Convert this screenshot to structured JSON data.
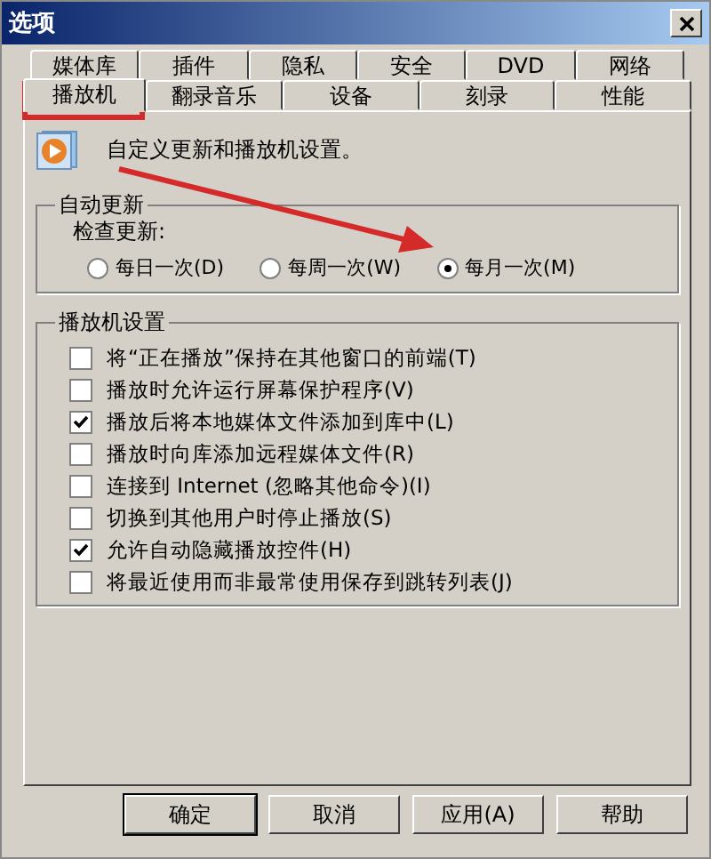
{
  "window": {
    "title": "选项"
  },
  "tab_rows": [
    [
      {
        "label": "媒体库",
        "selected": false
      },
      {
        "label": "插件",
        "selected": false
      },
      {
        "label": "隐私",
        "selected": false
      },
      {
        "label": "安全",
        "selected": false
      },
      {
        "label": "DVD",
        "selected": false
      },
      {
        "label": "网络",
        "selected": false
      }
    ],
    [
      {
        "label": "播放机",
        "selected": true
      },
      {
        "label": "翻录音乐",
        "selected": false
      },
      {
        "label": "设备",
        "selected": false
      },
      {
        "label": "刻录",
        "selected": false
      },
      {
        "label": "性能",
        "selected": false
      }
    ]
  ],
  "header": "自定义更新和播放机设置。",
  "auto_update": {
    "title": "自动更新",
    "label": "检查更新:",
    "options": [
      {
        "label": "每日一次(D)",
        "selected": false
      },
      {
        "label": "每周一次(W)",
        "selected": false
      },
      {
        "label": "每月一次(M)",
        "selected": true
      }
    ]
  },
  "player_settings": {
    "title": "播放机设置",
    "items": [
      {
        "label": "将“正在播放”保持在其他窗口的前端(T)",
        "checked": false
      },
      {
        "label": "播放时允许运行屏幕保护程序(V)",
        "checked": false
      },
      {
        "label": "播放后将本地媒体文件添加到库中(L)",
        "checked": true
      },
      {
        "label": "播放时向库添加远程媒体文件(R)",
        "checked": false
      },
      {
        "label": "连接到 Internet (忽略其他命令)(I)",
        "checked": false
      },
      {
        "label": "切换到其他用户时停止播放(S)",
        "checked": false
      },
      {
        "label": "允许自动隐藏播放控件(H)",
        "checked": true
      },
      {
        "label": "将最近使用而非最常使用保存到跳转列表(J)",
        "checked": false
      }
    ]
  },
  "buttons": [
    "确定",
    "取消",
    "应用(A)",
    "帮助"
  ]
}
